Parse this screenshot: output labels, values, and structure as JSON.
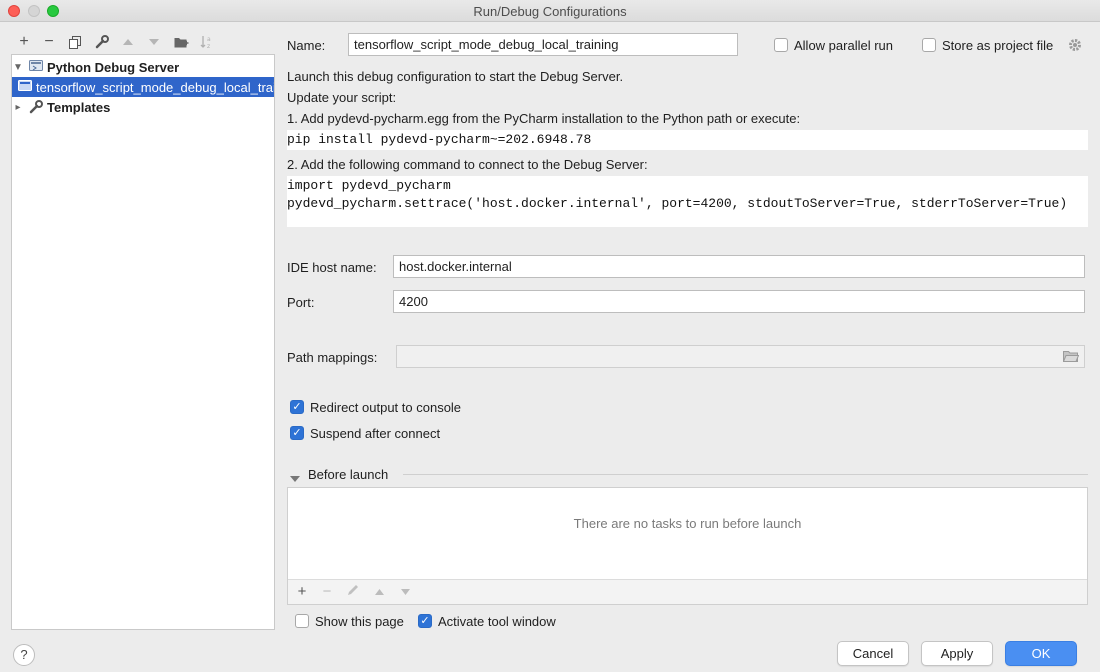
{
  "window": {
    "title": "Run/Debug Configurations"
  },
  "left_toolbar": {
    "icons": [
      "add-icon",
      "remove-icon",
      "copy-icon",
      "wrench-icon",
      "move-up-icon",
      "move-down-icon",
      "new-folder-icon",
      "sort-icon"
    ]
  },
  "tree": {
    "group": "Python Debug Server",
    "selected_item": "tensorflow_script_mode_debug_local_training",
    "templates": "Templates"
  },
  "form": {
    "name_label": "Name:",
    "name_value": "tensorflow_script_mode_debug_local_training",
    "allow_parallel": "Allow parallel run",
    "store_as_project": "Store as project file",
    "info_line1": "Launch this debug configuration to start the Debug Server.",
    "info_line2": "Update your script:",
    "info_line3": "1. Add pydevd-pycharm.egg from the PyCharm installation to the Python path or execute:",
    "code1": "pip install pydevd-pycharm~=202.6948.78",
    "info_line4": "2. Add the following command to connect to the Debug Server:",
    "code2_line1": "import pydevd_pycharm",
    "code2_line2": "pydevd_pycharm.settrace('host.docker.internal', port=4200, stdoutToServer=True, stderrToServer=True)",
    "ide_host_label": "IDE host name:",
    "ide_host_value": "host.docker.internal",
    "port_label": "Port:",
    "port_value": "4200",
    "path_mappings_label": "Path mappings:",
    "path_mappings_value": "",
    "redirect_output": "Redirect output to console",
    "suspend_after": "Suspend after connect"
  },
  "before_launch": {
    "title": "Before launch",
    "empty_text": "There are no tasks to run before launch",
    "show_this_page": "Show this page",
    "activate_tool_window": "Activate tool window"
  },
  "buttons": {
    "cancel": "Cancel",
    "apply": "Apply",
    "ok": "OK",
    "help": "?"
  },
  "colors": {
    "selection": "#2f65ca",
    "checkbox_checked": "#2e73d6",
    "primary_button": "#4a8ff2"
  }
}
